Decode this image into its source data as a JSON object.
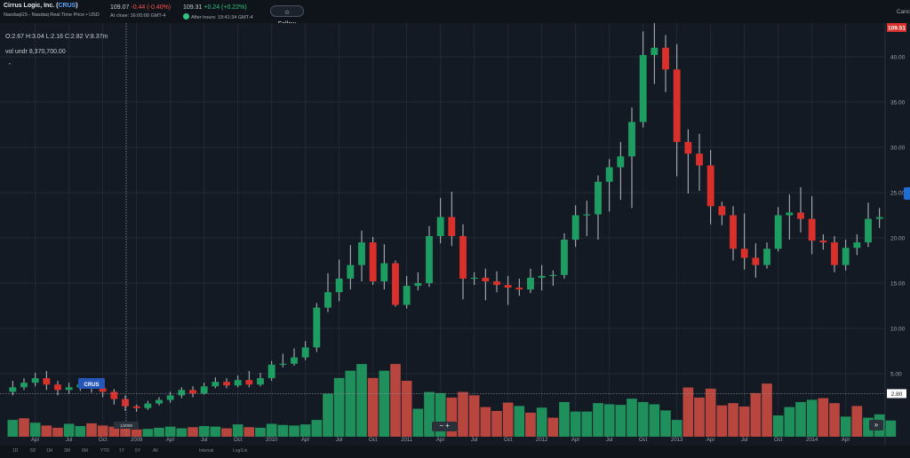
{
  "header": {
    "company": "Cirrus Logic, Inc. (",
    "ticker": "CRUS",
    "company_end": ")",
    "subtitle": "NasdaqGS - Nasdaq Real Time Price • USD",
    "close_price": "109.07",
    "close_change": "-0.44",
    "close_pct": "(-0.40%)",
    "close_meta": "At close: 16:00:00 GMT-4",
    "after_price": "109.31",
    "after_change": "+0.24",
    "after_pct": "(+0.22%)",
    "after_meta": "After hours: 19:41:34 GMT-4",
    "follow_label": "☆ Follow",
    "cancel_label": "Canc"
  },
  "legend": {
    "ohlc": "O:2.67  H:3.04  L:2.16  C:2.82  V:8.37m",
    "volume": "vol undr   8,370,700.00",
    "collapse": "⌃"
  },
  "tooltip": {
    "label": "CRUS"
  },
  "crosshair": {
    "date": "1/2009"
  },
  "price_badge": "109.51",
  "low_badge": "2.80",
  "zoom_controls": "− +",
  "ffwd": "»",
  "bottom_bar": [
    "1D",
    "5D",
    "1M",
    "3M",
    "6M",
    "YTD",
    "1Y",
    "5Y",
    "All",
    "Interval",
    "Log/Lin"
  ],
  "colors": {
    "up": "#1e9d62",
    "down": "#d9302c",
    "vol_up": "#1f8f5b",
    "vol_down": "#b8463f",
    "bg": "#131a23",
    "grid": "#222b36"
  },
  "chart_data": {
    "type": "candlestick",
    "y_ticks": [
      "5.00",
      "10.00",
      "15.00",
      "20.00",
      "25.00",
      "30.00",
      "35.00",
      "40.00"
    ],
    "ylim": [
      0,
      46
    ],
    "x_labels": [
      "Apr",
      "Jul",
      "Oct",
      "2009",
      "Apr",
      "Jul",
      "Oct",
      "2010",
      "Apr",
      "Jul",
      "Oct",
      "2011",
      "Apr",
      "Jul",
      "Oct",
      "2012",
      "Apr",
      "Jul",
      "Oct",
      "2013",
      "Apr",
      "Jul",
      "Oct",
      "2014",
      "Apr"
    ],
    "x_label_index": [
      2,
      5,
      8,
      11,
      14,
      17,
      20,
      23,
      26,
      29,
      32,
      35,
      38,
      41,
      44,
      47,
      50,
      53,
      56,
      59,
      62,
      65,
      68,
      71,
      74
    ],
    "candles": [
      [
        3,
        3.5,
        4.2,
        2.6
      ],
      [
        3.5,
        4.0,
        4.5,
        3.2
      ],
      [
        4.0,
        4.5,
        5.1,
        3.6
      ],
      [
        4.5,
        3.8,
        5.3,
        3.2
      ],
      [
        3.8,
        3.2,
        4.2,
        2.6
      ],
      [
        3.2,
        3.5,
        4.0,
        2.8
      ],
      [
        3.5,
        3.8,
        4.2,
        3.1
      ],
      [
        3.8,
        3.4,
        4.3,
        2.9
      ],
      [
        3.4,
        3.0,
        3.8,
        2.4
      ],
      [
        3.0,
        2.2,
        3.3,
        1.6
      ],
      [
        2.2,
        1.4,
        2.6,
        0.9
      ],
      [
        1.4,
        1.2,
        1.6,
        0.8
      ],
      [
        1.2,
        1.7,
        2.0,
        1.0
      ],
      [
        1.7,
        2.1,
        2.4,
        1.5
      ],
      [
        2.1,
        2.6,
        3.0,
        1.8
      ],
      [
        2.6,
        3.2,
        3.5,
        2.3
      ],
      [
        3.2,
        2.8,
        3.6,
        2.4
      ],
      [
        2.8,
        3.6,
        4.0,
        2.7
      ],
      [
        3.6,
        4.1,
        4.6,
        3.4
      ],
      [
        4.1,
        3.7,
        4.5,
        3.4
      ],
      [
        3.7,
        4.3,
        4.8,
        3.5
      ],
      [
        4.3,
        3.8,
        5.3,
        3.5
      ],
      [
        3.8,
        4.5,
        5.1,
        3.6
      ],
      [
        4.5,
        6.0,
        6.4,
        4.2
      ],
      [
        6.0,
        6.1,
        7.2,
        5.7
      ],
      [
        6.1,
        6.8,
        7.8,
        5.9
      ],
      [
        6.8,
        7.9,
        8.6,
        6.5
      ],
      [
        7.9,
        12.3,
        12.8,
        7.4
      ],
      [
        12.3,
        14.0,
        16.1,
        11.8
      ],
      [
        14.0,
        15.5,
        17.6,
        13.0
      ],
      [
        15.5,
        17.0,
        19.2,
        14.3
      ],
      [
        17.0,
        19.5,
        20.8,
        15.2
      ],
      [
        19.5,
        15.2,
        20.1,
        14.8
      ],
      [
        15.2,
        17.2,
        19.3,
        14.3
      ],
      [
        17.2,
        12.6,
        17.5,
        12.4
      ],
      [
        12.6,
        14.7,
        15.8,
        12.2
      ],
      [
        14.7,
        15.0,
        16.2,
        14.2
      ],
      [
        15.0,
        20.2,
        21.3,
        14.6
      ],
      [
        20.2,
        22.3,
        24.4,
        19.4
      ],
      [
        22.3,
        20.2,
        25.1,
        19.1
      ],
      [
        20.2,
        15.5,
        21.5,
        13.2
      ],
      [
        15.5,
        15.6,
        16.2,
        14.8
      ],
      [
        15.6,
        15.2,
        16.6,
        13.1
      ],
      [
        15.2,
        14.8,
        16.3,
        14.0
      ],
      [
        14.8,
        14.5,
        15.8,
        12.6
      ],
      [
        14.5,
        14.3,
        15.5,
        13.6
      ],
      [
        14.3,
        15.6,
        16.6,
        13.9
      ],
      [
        15.6,
        15.8,
        17.0,
        14.2
      ],
      [
        15.8,
        15.9,
        16.4,
        14.7
      ],
      [
        15.9,
        19.8,
        20.5,
        15.5
      ],
      [
        19.8,
        22.5,
        23.6,
        19.0
      ],
      [
        22.5,
        22.6,
        24.1,
        20.2
      ],
      [
        22.6,
        26.2,
        26.9,
        19.8
      ],
      [
        26.2,
        27.8,
        28.7,
        22.9
      ],
      [
        27.8,
        29.0,
        30.6,
        24.2
      ],
      [
        29.0,
        32.8,
        34.4,
        23.3
      ],
      [
        32.8,
        40.2,
        42.8,
        32.2
      ],
      [
        40.2,
        41.0,
        44.9,
        37.0
      ],
      [
        41.0,
        38.6,
        42.4,
        36.1
      ],
      [
        38.6,
        30.6,
        41.4,
        26.8
      ],
      [
        30.6,
        29.3,
        32.0,
        24.9
      ],
      [
        29.3,
        28.0,
        31.5,
        25.2
      ],
      [
        28.0,
        23.5,
        29.7,
        21.5
      ],
      [
        23.5,
        22.5,
        24.0,
        21.4
      ],
      [
        22.5,
        18.8,
        23.5,
        17.5
      ],
      [
        18.8,
        17.8,
        22.7,
        16.5
      ],
      [
        17.8,
        17.0,
        19.4,
        15.6
      ],
      [
        17.0,
        18.8,
        19.5,
        16.6
      ],
      [
        18.8,
        22.5,
        23.4,
        18.5
      ],
      [
        22.5,
        22.8,
        24.8,
        19.8
      ],
      [
        22.8,
        22.1,
        25.6,
        20.6
      ],
      [
        22.1,
        19.7,
        24.6,
        18.2
      ],
      [
        19.7,
        19.5,
        20.4,
        18.7
      ],
      [
        19.5,
        17.0,
        20.2,
        16.2
      ],
      [
        17.0,
        18.9,
        19.8,
        16.4
      ],
      [
        18.9,
        19.5,
        20.4,
        18.1
      ],
      [
        19.5,
        22.1,
        23.9,
        19.0
      ],
      [
        22.1,
        22.3,
        23.3,
        21.1
      ]
    ],
    "volume": [
      [
        3.0,
        "up"
      ],
      [
        3.3,
        "down"
      ],
      [
        2.5,
        "up"
      ],
      [
        2.0,
        "down"
      ],
      [
        1.6,
        "down"
      ],
      [
        2.3,
        "up"
      ],
      [
        1.9,
        "up"
      ],
      [
        2.4,
        "down"
      ],
      [
        2.0,
        "down"
      ],
      [
        1.8,
        "down"
      ],
      [
        1.5,
        "down"
      ],
      [
        1.3,
        "down"
      ],
      [
        1.4,
        "up"
      ],
      [
        1.6,
        "up"
      ],
      [
        1.8,
        "up"
      ],
      [
        1.5,
        "up"
      ],
      [
        1.7,
        "down"
      ],
      [
        1.9,
        "up"
      ],
      [
        1.8,
        "up"
      ],
      [
        1.5,
        "down"
      ],
      [
        2.2,
        "up"
      ],
      [
        1.7,
        "down"
      ],
      [
        1.6,
        "up"
      ],
      [
        2.3,
        "up"
      ],
      [
        2.1,
        "up"
      ],
      [
        2.0,
        "up"
      ],
      [
        2.2,
        "up"
      ],
      [
        3.0,
        "up"
      ],
      [
        7.7,
        "up"
      ],
      [
        10.5,
        "up"
      ],
      [
        11.8,
        "up"
      ],
      [
        13.0,
        "up"
      ],
      [
        10.5,
        "down"
      ],
      [
        11.8,
        "up"
      ],
      [
        13.0,
        "down"
      ],
      [
        10.0,
        "down"
      ],
      [
        5.0,
        "up"
      ],
      [
        8.0,
        "up"
      ],
      [
        7.8,
        "up"
      ],
      [
        7.0,
        "down"
      ],
      [
        8.0,
        "down"
      ],
      [
        7.4,
        "down"
      ],
      [
        5.3,
        "down"
      ],
      [
        4.6,
        "down"
      ],
      [
        6.1,
        "down"
      ],
      [
        5.5,
        "up"
      ],
      [
        4.3,
        "down"
      ],
      [
        5.2,
        "up"
      ],
      [
        3.4,
        "down"
      ],
      [
        6.2,
        "up"
      ],
      [
        4.5,
        "up"
      ],
      [
        4.5,
        "up"
      ],
      [
        6.0,
        "up"
      ],
      [
        5.8,
        "up"
      ],
      [
        5.7,
        "up"
      ],
      [
        6.8,
        "up"
      ],
      [
        6.2,
        "up"
      ],
      [
        5.8,
        "up"
      ],
      [
        4.7,
        "up"
      ],
      [
        3.0,
        "up"
      ],
      [
        8.8,
        "down"
      ],
      [
        7.0,
        "down"
      ],
      [
        8.6,
        "down"
      ],
      [
        5.6,
        "down"
      ],
      [
        6.0,
        "down"
      ],
      [
        5.4,
        "down"
      ],
      [
        7.8,
        "down"
      ],
      [
        9.5,
        "down"
      ],
      [
        3.8,
        "up"
      ],
      [
        5.3,
        "up"
      ],
      [
        6.2,
        "up"
      ],
      [
        6.6,
        "up"
      ],
      [
        6.9,
        "down"
      ],
      [
        6.0,
        "down"
      ],
      [
        3.6,
        "up"
      ],
      [
        5.5,
        "down"
      ],
      [
        3.4,
        "up"
      ],
      [
        4.0,
        "up"
      ],
      [
        2.9,
        "up"
      ]
    ]
  }
}
